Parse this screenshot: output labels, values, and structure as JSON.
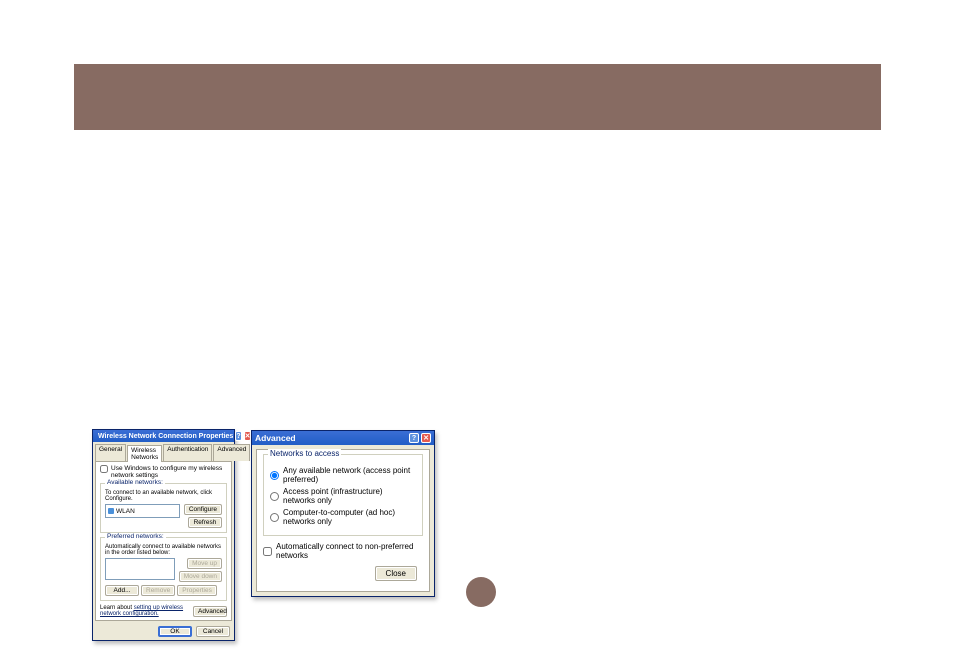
{
  "dlg1": {
    "title": "Wireless Network Connection Properties",
    "tabs": {
      "general": "General",
      "wireless": "Wireless Networks",
      "auth": "Authentication",
      "advanced": "Advanced"
    },
    "use_windows_label": "Use Windows to configure my wireless network settings",
    "available": {
      "legend": "Available networks:",
      "desc": "To connect to an available network, click Configure.",
      "item0": "WLAN",
      "btn_configure": "Configure",
      "btn_refresh": "Refresh"
    },
    "preferred": {
      "legend": "Preferred networks:",
      "desc": "Automatically connect to available networks in the order listed below:",
      "btn_moveup": "Move up",
      "btn_movedown": "Move down",
      "btn_add": "Add...",
      "btn_remove": "Remove",
      "btn_properties": "Properties"
    },
    "learn_prefix": "Learn about ",
    "learn_link": "setting up wireless network configuration.",
    "btn_advanced": "Advanced",
    "btn_ok": "OK",
    "btn_cancel": "Cancel"
  },
  "dlg2": {
    "title": "Advanced",
    "group_legend": "Networks to access",
    "opt_any": "Any available network (access point preferred)",
    "opt_infra": "Access point (infrastructure) networks only",
    "opt_adhoc": "Computer-to-computer (ad hoc) networks only",
    "auto_connect": "Automatically connect to non-preferred networks",
    "btn_close": "Close"
  }
}
